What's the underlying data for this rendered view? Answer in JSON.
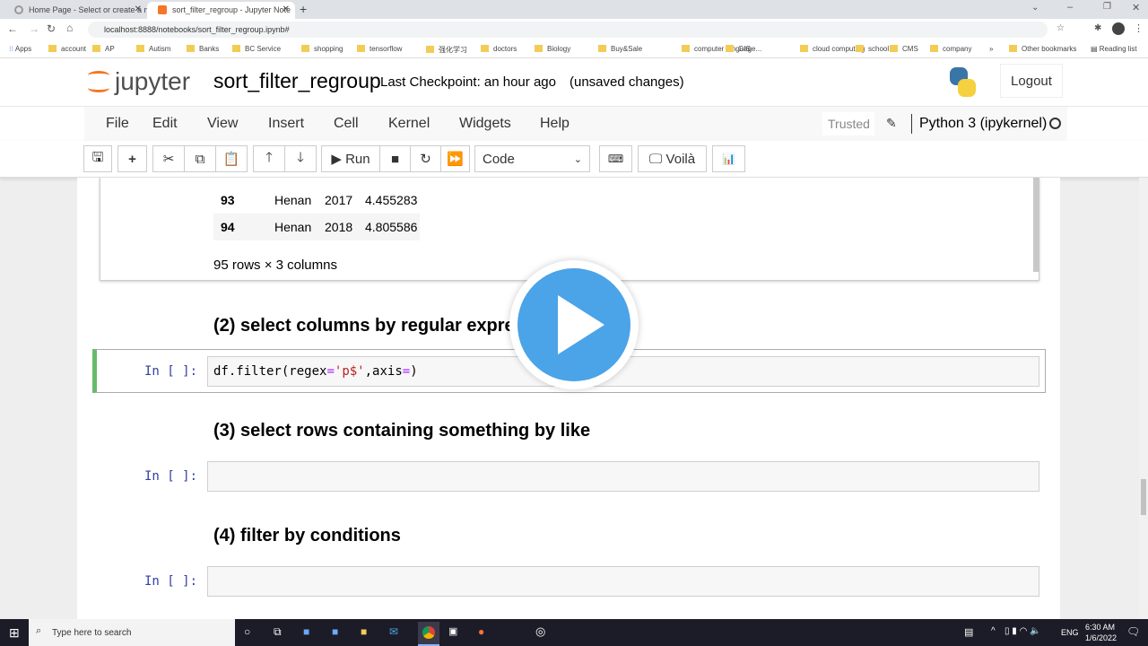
{
  "browser": {
    "tabs": [
      {
        "title": "Home Page - Select or create a n"
      },
      {
        "title": "sort_filter_regroup - Jupyter Note"
      }
    ],
    "url": "localhost:8888/notebooks/sort_filter_regroup.ipynb#",
    "bookmarks": [
      "account",
      "AP",
      "Autism",
      "Banks",
      "BC Service",
      "shopping",
      "tensorflow",
      "强化学习",
      "doctors",
      "Biology",
      "Buy&Sale",
      "computer language...",
      "GIS",
      "cloud computing",
      "school",
      "CMS",
      "company"
    ],
    "apps": "Apps",
    "other_bookmarks": "Other bookmarks",
    "reading_list": "Reading list"
  },
  "jupyter": {
    "logo": "jupyter",
    "notebook_name": "sort_filter_regroup",
    "checkpoint": "Last Checkpoint: an hour ago",
    "unsaved": "(unsaved changes)",
    "logout": "Logout",
    "menu": [
      "File",
      "Edit",
      "View",
      "Insert",
      "Cell",
      "Kernel",
      "Widgets",
      "Help"
    ],
    "trusted": "Trusted",
    "kernel": "Python 3 (ipykernel)",
    "toolbar": {
      "run": "Run",
      "cell_type": "Code",
      "voila": "Voilà"
    }
  },
  "notebook": {
    "table_rows": [
      {
        "index": "93",
        "province": "Henan",
        "year": "2017",
        "value": "4.455283"
      },
      {
        "index": "94",
        "province": "Henan",
        "year": "2018",
        "value": "4.805586"
      }
    ],
    "shape": "95 rows × 3 columns",
    "heading2": "(2) select columns by regular expression (regex)",
    "code_prompt": "In [ ]:",
    "code_parts": [
      "df.filter(",
      "regex",
      "=",
      "'p$'",
      ",axis",
      "=",
      ")"
    ],
    "heading3": "(3) select rows containing something by like",
    "heading4": "(4) filter by conditions"
  },
  "taskbar": {
    "search": "Type here to search",
    "lang": "ENG",
    "time": "6:30 AM",
    "date": "1/6/2022"
  },
  "colors": {
    "accent_green": "#66bb6a",
    "play_blue": "#4ba3e8",
    "jupyter_orange": "#f37726"
  }
}
